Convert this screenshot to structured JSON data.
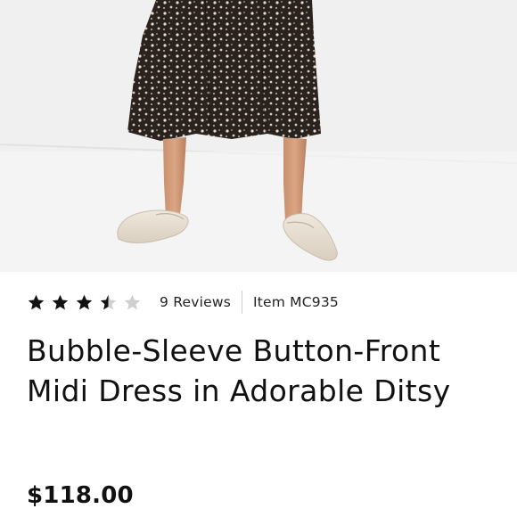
{
  "product": {
    "image_alt": "Model wearing printed midi dress with cream loafer mules",
    "rating": {
      "value": 3.5,
      "max": 5,
      "stars": [
        "full",
        "full",
        "full",
        "half",
        "empty"
      ]
    },
    "reviews_label": "9 Reviews",
    "item_label": "Item MC935",
    "title": "Bubble-Sleeve Button-Front Midi Dress in Adorable Ditsy",
    "price": "$118.00"
  },
  "colors": {
    "star_filled": "#111111",
    "star_empty": "#cfcfcf",
    "divider": "#cfcfcf",
    "text": "#111111",
    "background": "#ffffff"
  }
}
